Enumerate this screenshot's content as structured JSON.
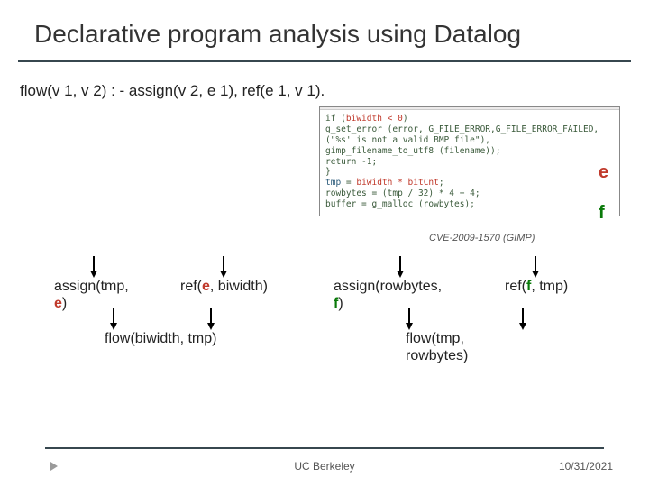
{
  "title": "Declarative program analysis using Datalog",
  "rule": "flow(v 1, v 2) : - assign(v 2, e 1), ref(e 1, v 1).",
  "code": {
    "header": "",
    "line1_pre": "if (",
    "line1_cond": "biwidth < 0",
    "line1_post": ")",
    "line2a": "   g_set_error (error, G_FILE_ERROR,G_FILE_ERROR_FAILED,",
    "line2b": "                (\"%s' is not a valid BMP file\"),",
    "line2c": "                gimp_filename_to_utf8 (filename));",
    "line3": "   return -1;",
    "line4": "}",
    "line5_lhs": "tmp",
    "line5_rhs": "biwidth * bitCnt",
    "line5_eq": " = ",
    "line5_end": ";",
    "line6": "rowbytes = (tmp / 32) * 4 + 4;",
    "line7": "buffer = g_malloc (rowbytes);"
  },
  "cve": "CVE-2009-1570 (GIMP)",
  "label_e": "e",
  "label_f": "f",
  "facts": {
    "assign_tmp_pre": "assign(tmp,",
    "assign_tmp_post": ")",
    "ref_e_pre": "ref(",
    "ref_e_mid": ", biwidth)",
    "assign_row_pre": "assign(rowbytes,",
    "assign_row_post": ")",
    "ref_f_pre": "ref(",
    "ref_f_mid": ", tmp)",
    "flow1": "flow(biwidth, tmp)",
    "flow2a": "flow(tmp,",
    "flow2b": "rowbytes)",
    "e": "e",
    "f": "f"
  },
  "footer": {
    "center": "UC Berkeley",
    "right": "10/31/2021"
  }
}
